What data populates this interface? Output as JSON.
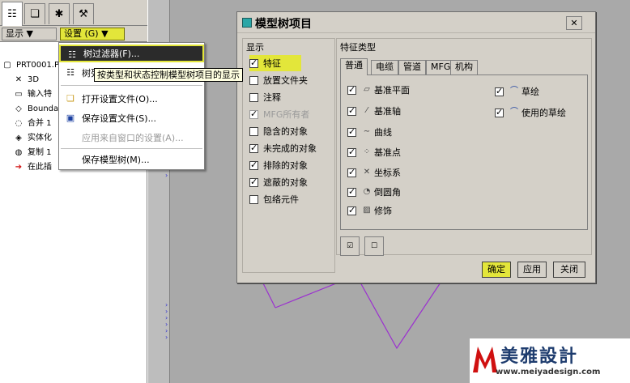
{
  "left_panel": {
    "tabs": [
      {
        "icon": "model-tree-icon"
      },
      {
        "icon": "folder-icon"
      },
      {
        "icon": "favorites-icon"
      },
      {
        "icon": "tools-icon"
      }
    ],
    "toolbar": {
      "show_label": "显示 ▼",
      "settings_label": "设置 (G) ▼"
    },
    "tree": [
      {
        "label": "PRT0001.PR",
        "icon": "part-icon"
      },
      {
        "label": "3D",
        "icon": "3d-note-icon"
      },
      {
        "label": "输入特",
        "icon": "import-feature-icon"
      },
      {
        "label": "Boundar",
        "icon": "boundary-blend-icon"
      },
      {
        "label": "合并 1",
        "icon": "merge-icon"
      },
      {
        "label": "实体化",
        "icon": "solidify-icon"
      },
      {
        "label": "复制 1",
        "icon": "copy-icon"
      },
      {
        "label": "在此插",
        "icon": "insert-here-icon"
      }
    ]
  },
  "menu": {
    "items": [
      {
        "label": "树过滤器(F)...",
        "icon": "tree-filter-icon",
        "highlighted": true
      },
      {
        "label": "树列",
        "icon": "tree-columns-icon"
      },
      {
        "label": "打开设置文件(O)...",
        "icon": "open-folder-icon"
      },
      {
        "label": "保存设置文件(S)...",
        "icon": "save-icon"
      },
      {
        "label": "应用来自窗口的设置(A)...",
        "icon": "",
        "disabled": true
      },
      {
        "label": "保存模型树(M)...",
        "icon": ""
      }
    ]
  },
  "tooltip": "按类型和状态控制模型树项目的显示",
  "dialog": {
    "title": "模型树项目",
    "close_glyph": "✕",
    "show_label": "显示",
    "feature_types_label": "特征类型",
    "show_items": [
      {
        "label": "特征",
        "checked": true,
        "highlighted": true
      },
      {
        "label": "放置文件夹",
        "checked": false
      },
      {
        "label": "注释",
        "checked": false
      },
      {
        "label": "MFG所有者",
        "checked": true,
        "disabled": true
      },
      {
        "label": "隐含的对象",
        "checked": false
      },
      {
        "label": "未完成的对象",
        "checked": true
      },
      {
        "label": "排除的对象",
        "checked": true
      },
      {
        "label": "遮蔽的对象",
        "checked": true
      },
      {
        "label": "包络元件",
        "checked": false
      }
    ],
    "tabs": [
      {
        "label": "普通",
        "active": true
      },
      {
        "label": "电缆"
      },
      {
        "label": "管道"
      },
      {
        "label": "MFG"
      },
      {
        "label": "机构"
      }
    ],
    "features_left": [
      {
        "label": "基准平面",
        "icon": "datum-plane-icon",
        "checked": true
      },
      {
        "label": "基准轴",
        "icon": "datum-axis-icon",
        "checked": true
      },
      {
        "label": "曲线",
        "icon": "curve-icon",
        "checked": true
      },
      {
        "label": "基准点",
        "icon": "datum-point-icon",
        "checked": true
      },
      {
        "label": "坐标系",
        "icon": "coordinate-system-icon",
        "checked": true
      },
      {
        "label": "倒圆角",
        "icon": "round-icon",
        "checked": true
      },
      {
        "label": "修饰",
        "icon": "cosmetic-icon",
        "checked": true
      }
    ],
    "features_right": [
      {
        "label": "草绘",
        "icon": "sketch-icon",
        "checked": true
      },
      {
        "label": "使用的草绘",
        "icon": "used-sketch-icon",
        "checked": true
      }
    ],
    "buttons": {
      "ok": "确定",
      "apply": "应用",
      "close": "关闭"
    },
    "select_all_icon": "select-all-icon",
    "clear_all_icon": "clear-all-icon"
  },
  "watermark": {
    "text": "美雅設計",
    "url": "www.meiyadesign.com"
  },
  "colors": {
    "highlight": "#e3e63a",
    "panel": "#d4d0c8",
    "graphics": "#a9a9a9",
    "sketch_line": "#9b2fd0"
  }
}
